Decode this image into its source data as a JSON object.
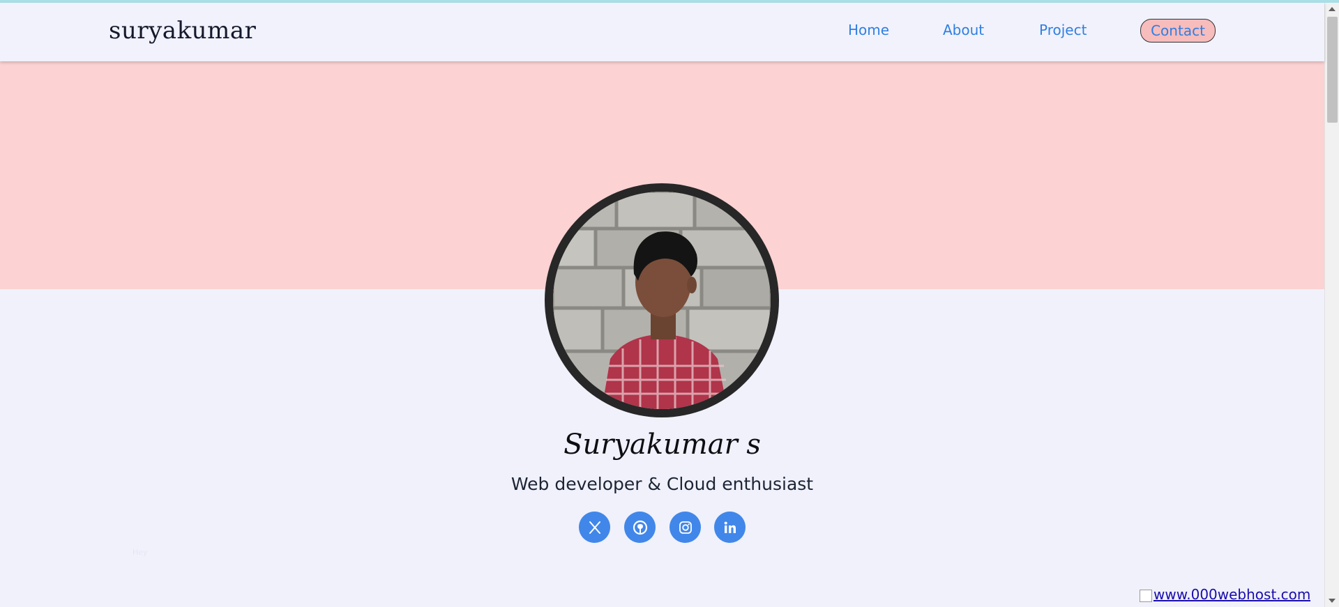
{
  "brand": {
    "name": "suryakumar"
  },
  "nav": {
    "home": "Home",
    "about": "About",
    "project": "Project",
    "contact": "Contact"
  },
  "profile": {
    "name": "Suryakumar s",
    "tagline": "Web developer & Cloud enthusiast"
  },
  "social": [
    {
      "icon": "x-twitter-icon"
    },
    {
      "icon": "github-icon"
    },
    {
      "icon": "instagram-icon"
    },
    {
      "icon": "linkedin-icon"
    }
  ],
  "footer": {
    "faint_text": "Hey",
    "host_link": "www.000webhost.com"
  },
  "colors": {
    "accent": "#4187ea",
    "nav_link": "#2f7fe0",
    "hero_band": "#fcd2d3",
    "contact_bg": "#f7bcbc",
    "page_bg": "#f0f1fb"
  }
}
